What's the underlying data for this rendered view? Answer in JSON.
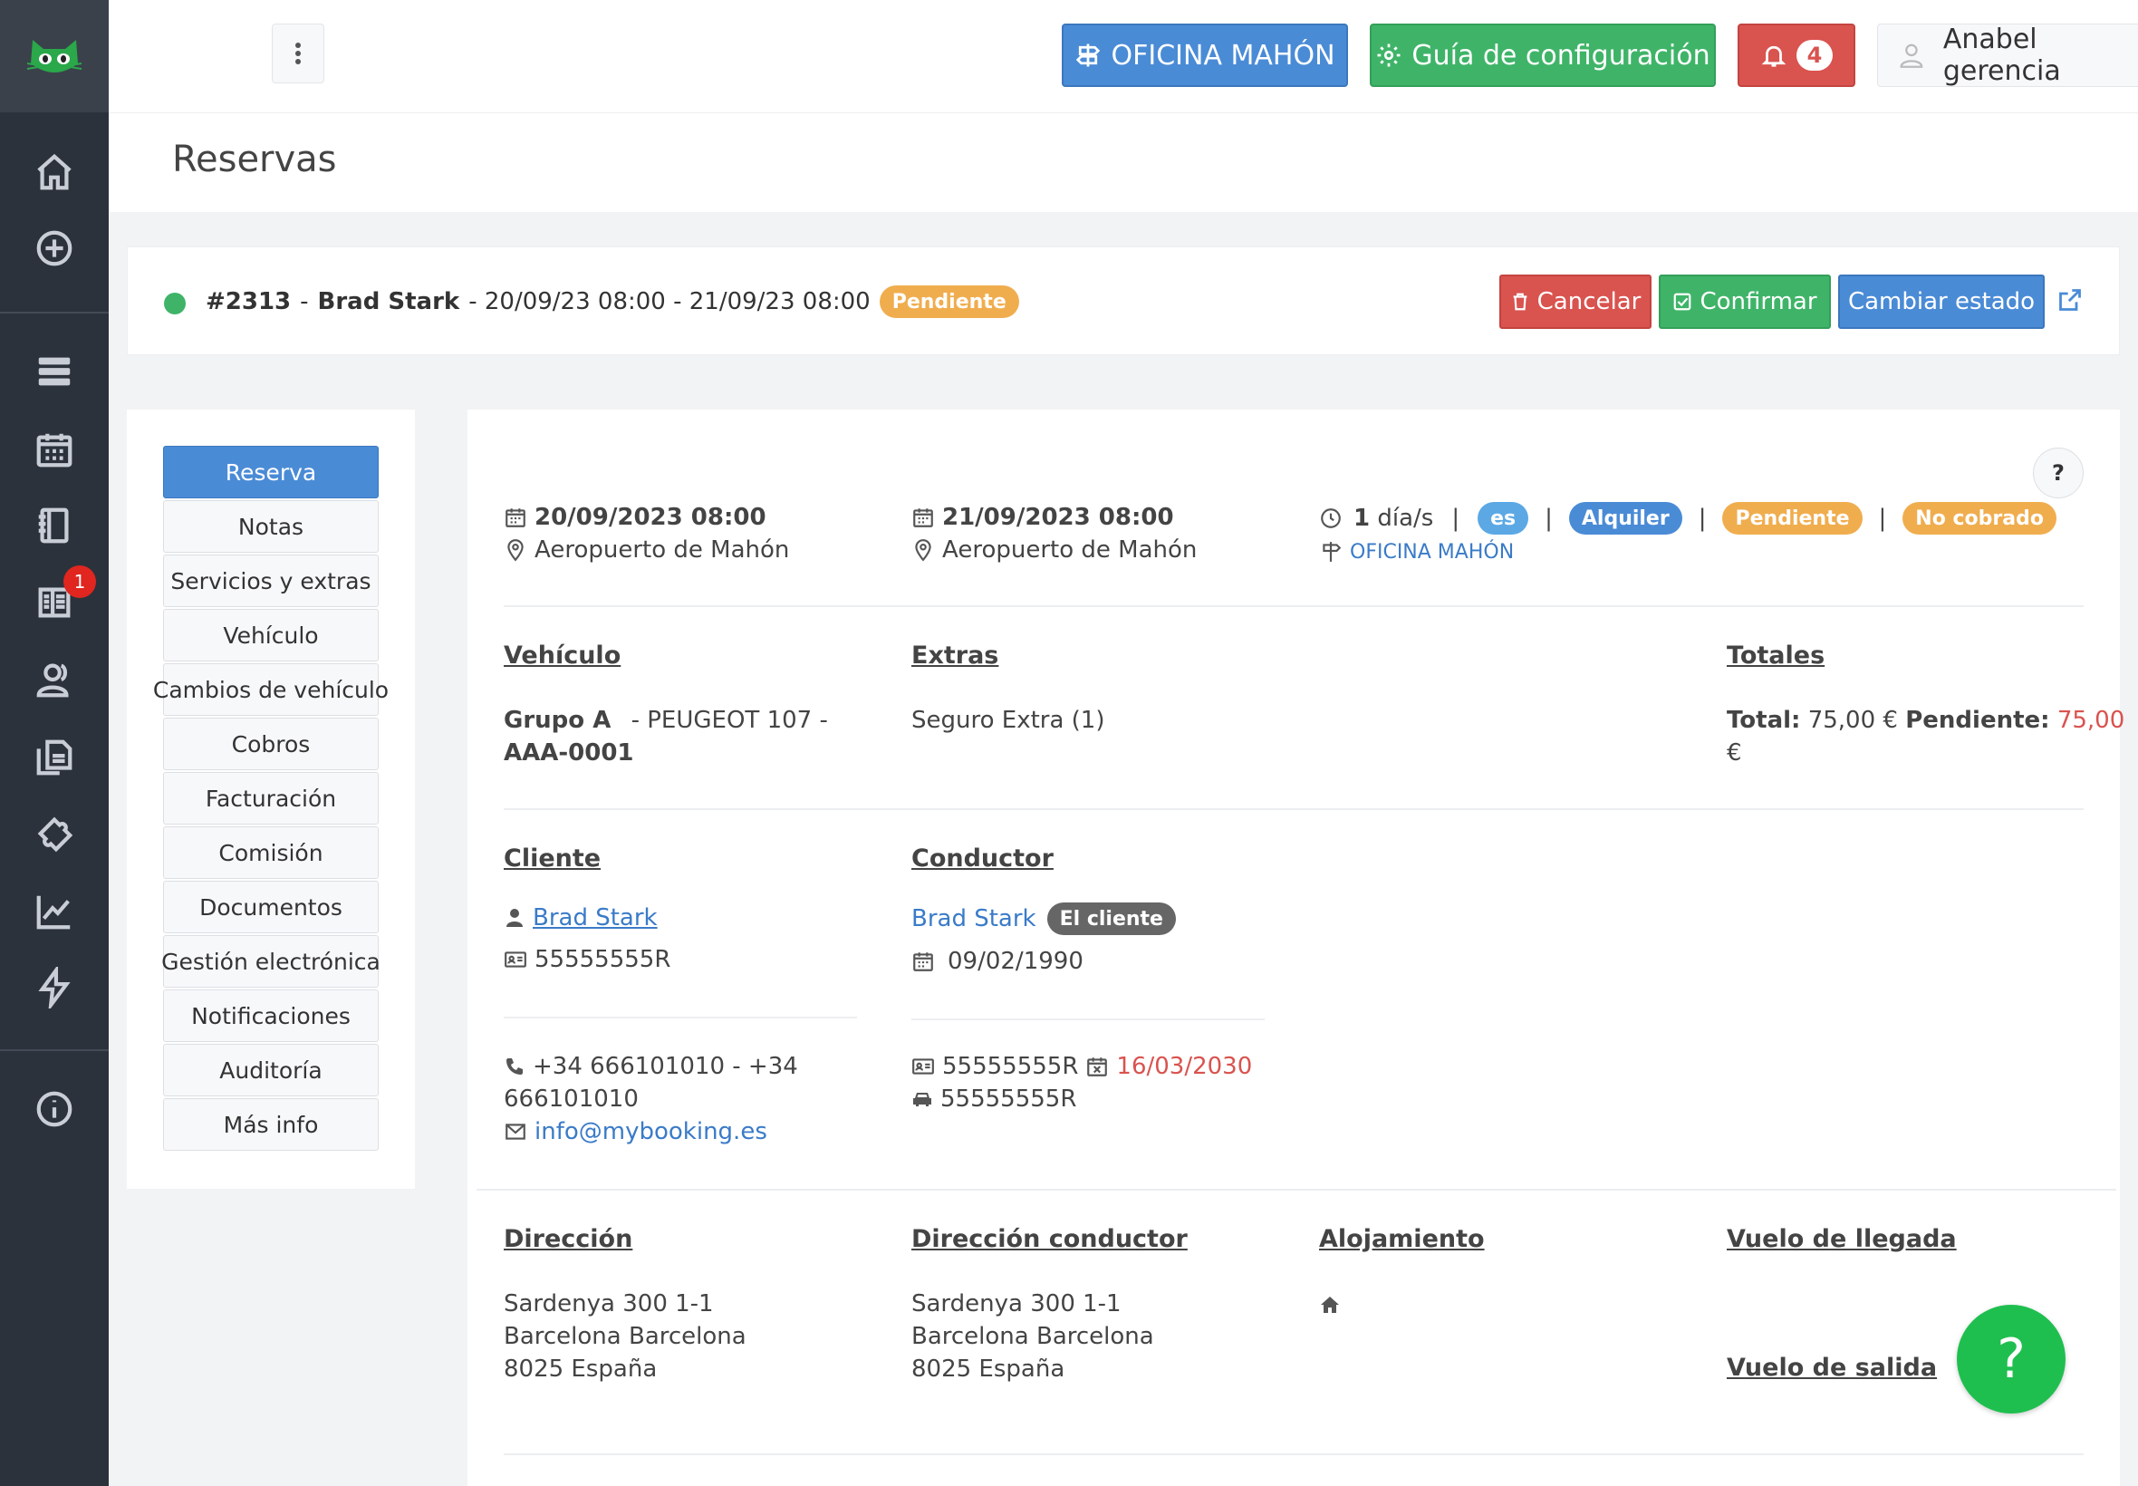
{
  "topbar": {
    "office_label": "OFICINA MAHÓN",
    "guide_label": "Guía de configuración",
    "notifications_count": "4",
    "user_name": "Anabel gerencia"
  },
  "sidebar": {
    "items": [
      {
        "icon": "home-icon"
      },
      {
        "icon": "plus-circle-icon"
      },
      {
        "icon": "server-icon"
      },
      {
        "icon": "calendar-icon"
      },
      {
        "icon": "notebook-icon"
      },
      {
        "icon": "book-icon",
        "badge": "1"
      },
      {
        "icon": "users-icon"
      },
      {
        "icon": "documents-icon"
      },
      {
        "icon": "puzzle-icon"
      },
      {
        "icon": "chart-icon"
      },
      {
        "icon": "lightning-icon"
      },
      {
        "icon": "info-icon"
      }
    ]
  },
  "page": {
    "title": "Reservas"
  },
  "reservation": {
    "number": "#2313",
    "sep1": "-",
    "customer": "Brad Stark",
    "dates": "- 20/09/23 08:00 - 21/09/23 08:00",
    "status": "Pendiente",
    "cancel_label": "Cancelar",
    "confirm_label": "Confirmar",
    "change_state_label": "Cambiar estado"
  },
  "tabs": [
    "Reserva",
    "Notas",
    "Servicios y extras",
    "Vehículo",
    "Cambios de vehículo",
    "Cobros",
    "Facturación",
    "Comisión",
    "Documentos",
    "Gestión electrónica",
    "Notificaciones",
    "Auditoría",
    "Más info"
  ],
  "summary": {
    "pickup_date": "20/09/2023 08:00",
    "pickup_place": "Aeropuerto de Mahón",
    "return_date": "21/09/2023 08:00",
    "return_place": "Aeropuerto de Mahón",
    "duration_num": "1",
    "duration_unit": "día/s",
    "lang": "es",
    "type": "Alquiler",
    "status": "Pendiente",
    "payment": "No cobrado",
    "separator": "|",
    "office": "OFICINA MAHÓN",
    "help": "?"
  },
  "vehicle": {
    "title": "Vehículo",
    "group": "Grupo A",
    "model": "- PEUGEOT 107   -",
    "plate": "AAA-0001"
  },
  "extras": {
    "title": "Extras",
    "item": "Seguro Extra (1)"
  },
  "totals": {
    "title": "Totales",
    "total_label": "Total:",
    "total_value": "75,00 €",
    "pending_label": "Pendiente:",
    "pending_value_1": "75,00",
    "pending_value_2": "€"
  },
  "client": {
    "title": "Cliente",
    "name": "Brad Stark",
    "id": "55555555R",
    "phone_1": "+34 666101010 - +34",
    "phone_2": "666101010",
    "email": "info@mybooking.es"
  },
  "driver": {
    "title": "Conductor",
    "name": "Brad Stark",
    "badge": "El cliente",
    "birth": "09/02/1990",
    "id": "55555555R",
    "id_expiry": "16/03/2030",
    "license": "55555555R"
  },
  "address": {
    "title": "Dirección",
    "line1": "Sardenya 300 1-1",
    "line2": "Barcelona Barcelona",
    "line3": "8025 España"
  },
  "driver_address": {
    "title": "Dirección conductor",
    "line1": "Sardenya 300 1-1",
    "line2": "Barcelona Barcelona",
    "line3": "8025 España"
  },
  "lodging": {
    "title": "Alojamiento"
  },
  "flights": {
    "arrival_title": "Vuelo de llegada",
    "departure_title": "Vuelo de salida"
  },
  "fab": {
    "label": "?"
  }
}
